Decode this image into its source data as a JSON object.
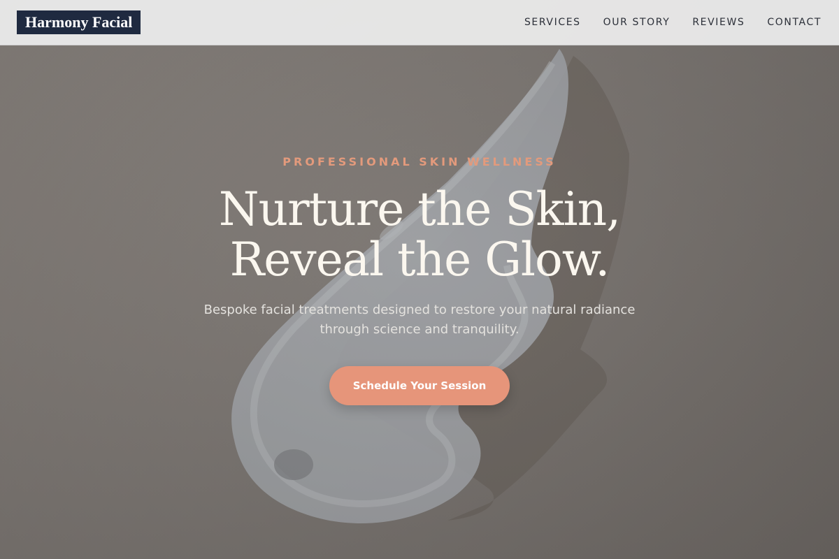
{
  "brand": {
    "logo_text": "Harmony Facial"
  },
  "nav": {
    "items": [
      {
        "label": "SERVICES"
      },
      {
        "label": "OUR STORY"
      },
      {
        "label": "REVIEWS"
      },
      {
        "label": "CONTACT"
      }
    ]
  },
  "hero": {
    "eyebrow": "PROFESSIONAL SKIN WELLNESS",
    "headline_line1": "Nurture the Skin,",
    "headline_line2": "Reveal the Glow.",
    "subtitle": "Bespoke facial treatments designed to restore your natural radiance through science and tranquility.",
    "cta_label": "Schedule Your Session"
  },
  "colors": {
    "brand_navy": "#1f2a40",
    "accent_peach": "#e6957a",
    "eyebrow_peach": "#e39a7c",
    "headline_cream": "#fbf7ef"
  }
}
